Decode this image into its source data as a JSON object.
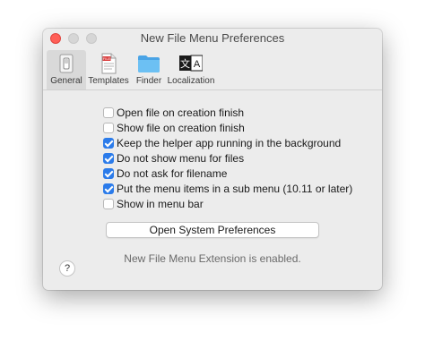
{
  "window": {
    "title": "New File Menu Preferences"
  },
  "toolbar": {
    "tabs": [
      {
        "label": "General",
        "icon": "general-switch-icon",
        "selected": true
      },
      {
        "label": "Templates",
        "icon": "templates-file-icon",
        "selected": false
      },
      {
        "label": "Finder",
        "icon": "finder-folder-icon",
        "selected": false
      },
      {
        "label": "Localization",
        "icon": "localization-icon",
        "selected": false
      }
    ],
    "localization_glyph_a": "文",
    "localization_glyph_b": "A",
    "templates_badge": "FILE"
  },
  "options": [
    {
      "label": "Open file on creation finish",
      "checked": false
    },
    {
      "label": "Show file on creation finish",
      "checked": false
    },
    {
      "label": "Keep the helper app running in the background",
      "checked": true
    },
    {
      "label": "Do not show menu for files",
      "checked": true
    },
    {
      "label": "Do not ask for filename",
      "checked": true
    },
    {
      "label": "Put the menu items in a sub menu (10.11 or later)",
      "checked": true
    },
    {
      "label": "Show in menu bar",
      "checked": false
    }
  ],
  "buttons": {
    "open_system_preferences": "Open System Preferences",
    "help": "?"
  },
  "status": "New File Menu Extension is enabled.",
  "colors": {
    "accent": "#2b7bea",
    "close_button": "#ff5f57",
    "folder": "#5ab0ec"
  }
}
